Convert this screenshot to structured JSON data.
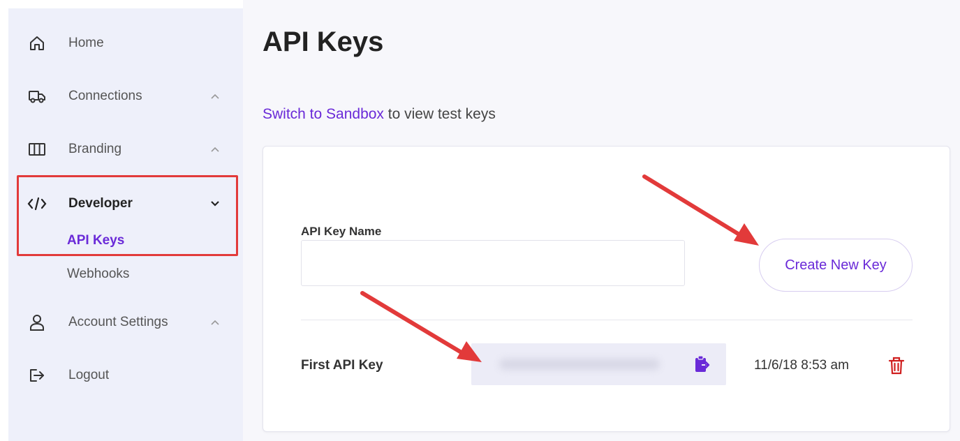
{
  "sidebar": {
    "items": [
      {
        "label": "Home",
        "icon": "home-icon"
      },
      {
        "label": "Connections",
        "icon": "truck-icon"
      },
      {
        "label": "Branding",
        "icon": "columns-icon"
      },
      {
        "label": "Developer",
        "icon": "code-icon",
        "expanded": true
      },
      {
        "label": "Account Settings",
        "icon": "user-icon"
      },
      {
        "label": "Logout",
        "icon": "logout-icon"
      }
    ],
    "developer_subitems": [
      {
        "label": "API Keys",
        "active": true
      },
      {
        "label": "Webhooks",
        "active": false
      }
    ]
  },
  "main": {
    "title": "API Keys",
    "sandbox_link": "Switch to Sandbox",
    "sandbox_suffix": " to view test keys",
    "form": {
      "field_label": "API Key Name",
      "field_value": "",
      "create_button": "Create New Key"
    },
    "keys": [
      {
        "name": "First API Key",
        "created": "11/6/18 8:53 am"
      }
    ]
  },
  "colors": {
    "accent": "#6a2ad8",
    "annotation": "#e23a3a",
    "delete": "#d01f1f"
  }
}
